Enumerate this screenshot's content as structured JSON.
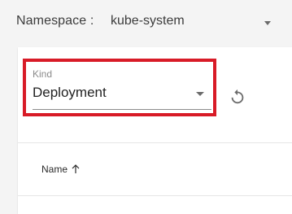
{
  "namespace": {
    "label": "Namespace :",
    "value": "kube-system"
  },
  "kind_select": {
    "label": "Kind",
    "value": "Deployment"
  },
  "table": {
    "columns": [
      {
        "label": "Name",
        "sort": "ascending"
      }
    ]
  },
  "icons": {
    "namespace_dropdown": "caret-down-icon",
    "kind_dropdown": "caret-down-icon",
    "refresh": "refresh-icon",
    "sort": "arrow-up-icon"
  },
  "colors": {
    "highlight": "#d81b27",
    "background": "#f4f4f4",
    "card": "#ffffff"
  }
}
